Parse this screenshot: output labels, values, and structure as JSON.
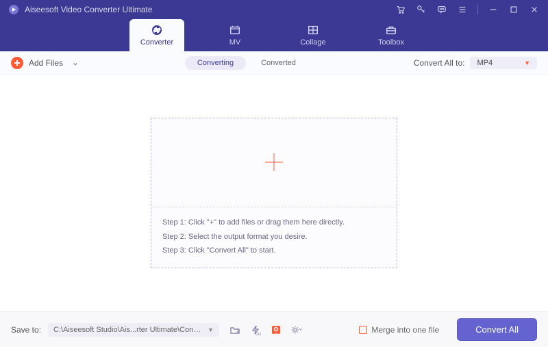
{
  "app": {
    "title": "Aiseesoft Video Converter Ultimate"
  },
  "tabs": {
    "converter": "Converter",
    "mv": "MV",
    "collage": "Collage",
    "toolbox": "Toolbox"
  },
  "toolbar": {
    "add_files": "Add Files",
    "seg_converting": "Converting",
    "seg_converted": "Converted",
    "convert_all_to": "Convert All to:",
    "format": "MP4"
  },
  "dropzone": {
    "step1": "Step 1: Click \"+\" to add files or drag them here directly.",
    "step2": "Step 2: Select the output format you desire.",
    "step3": "Step 3: Click \"Convert All\" to start."
  },
  "bottom": {
    "save_to_label": "Save to:",
    "path": "C:\\Aiseesoft Studio\\Ais...rter Ultimate\\Converted",
    "merge_label": "Merge into one file",
    "convert_all": "Convert All"
  }
}
